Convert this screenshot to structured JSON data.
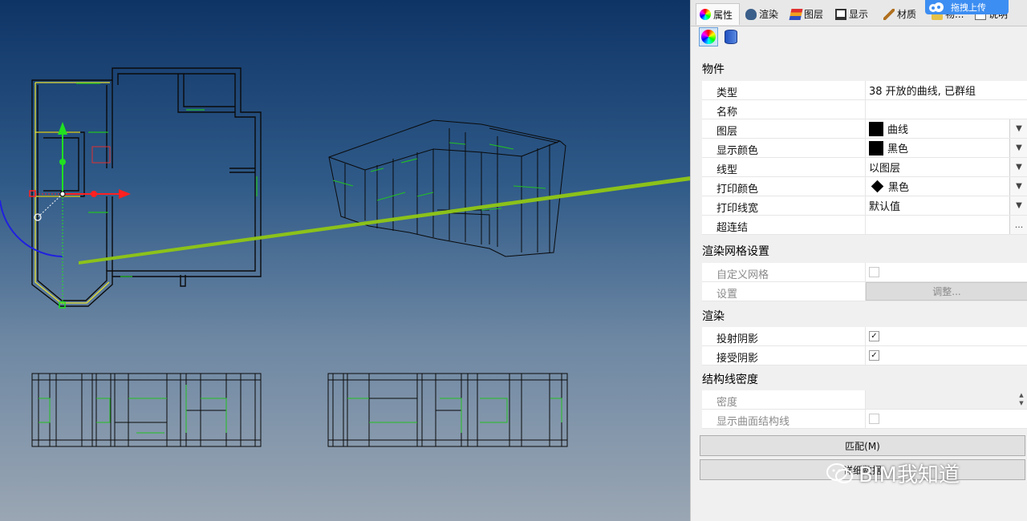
{
  "tabs": [
    {
      "label": "属性",
      "icon": "color-wheel-icon"
    },
    {
      "label": "渲染",
      "icon": "teapot-icon"
    },
    {
      "label": "图层",
      "icon": "layers-icon"
    },
    {
      "label": "显示",
      "icon": "monitor-icon"
    },
    {
      "label": "材质",
      "icon": "brush-icon"
    },
    {
      "label": "物...",
      "icon": "folder-icon"
    },
    {
      "label": "说明",
      "icon": "document-icon"
    }
  ],
  "upload_button": "拖拽上传",
  "sections": {
    "object": "物件",
    "render_mesh": "渲染网格设置",
    "render": "渲染",
    "isocurve": "结构线密度"
  },
  "object_rows": {
    "type": {
      "label": "类型",
      "value": "38 开放的曲线, 已群组"
    },
    "name": {
      "label": "名称",
      "value": ""
    },
    "layer": {
      "label": "图层",
      "value": "曲线"
    },
    "display_color": {
      "label": "显示颜色",
      "value": "黑色"
    },
    "linetype": {
      "label": "线型",
      "value": "以图层"
    },
    "print_color": {
      "label": "打印颜色",
      "value": "黑色"
    },
    "print_width": {
      "label": "打印线宽",
      "value": "默认值"
    },
    "hyperlink": {
      "label": "超连结",
      "value": "",
      "button": "..."
    }
  },
  "mesh_rows": {
    "custom_mesh": {
      "label": "自定义网格",
      "checked": false
    },
    "settings": {
      "label": "设置",
      "button": "调整..."
    }
  },
  "render_rows": {
    "cast_shadows": {
      "label": "投射阴影",
      "checked": true
    },
    "receive_shadows": {
      "label": "接受阴影",
      "checked": true
    }
  },
  "iso_rows": {
    "density": {
      "label": "密度",
      "value": ""
    },
    "show_isocurves": {
      "label": "显示曲面结构线",
      "checked": false
    }
  },
  "buttons": {
    "match": "匹配(M)",
    "details": "详细数据"
  },
  "watermark": "BIM我知道",
  "colors": {
    "arrow": "#8cc21a",
    "gumball_x": "#ff2020",
    "gumball_y": "#20e020",
    "selection": "#ffff40",
    "wire": "#0a0a0a",
    "green_lines": "#22c022"
  }
}
